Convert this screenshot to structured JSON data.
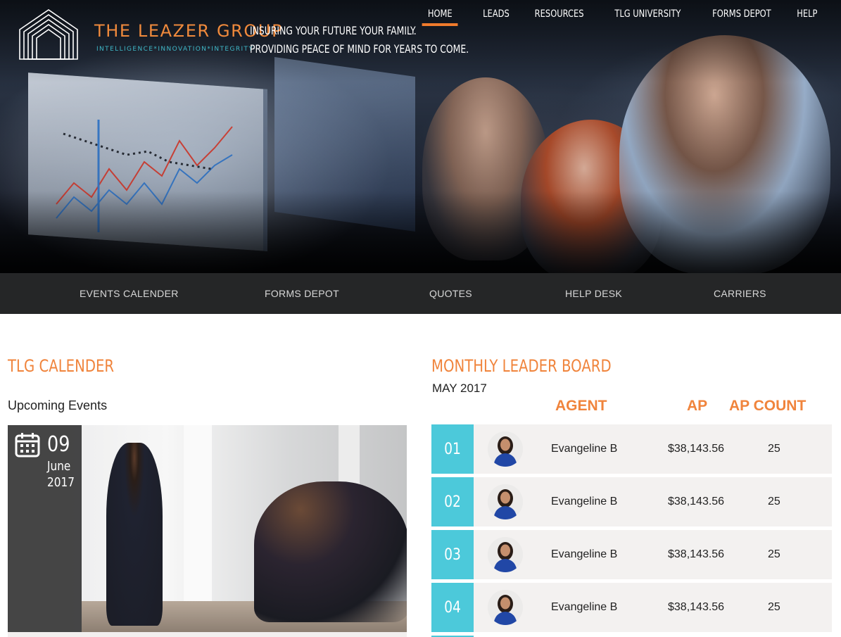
{
  "brand": {
    "name": "THE LEAZER GROUP",
    "tagline": "INTELLIGENCE*INNOVATION*INTEGRITY",
    "slogan_line1": "INSURING YOUR FUTURE YOUR FAMILY.",
    "slogan_line2": "PROVIDING PEACE OF MIND FOR YEARS TO COME."
  },
  "topnav": [
    {
      "label": "HOME",
      "active": true
    },
    {
      "label": "LEADS"
    },
    {
      "label": "RESOURCES"
    },
    {
      "label": "TLG UNIVERSITY"
    },
    {
      "label": "FORMS DEPOT"
    },
    {
      "label": "HELP"
    }
  ],
  "subnav": [
    {
      "label": "EVENTS CALENDER"
    },
    {
      "label": "FORMS DEPOT"
    },
    {
      "label": "QUOTES"
    },
    {
      "label": "HELP DESK"
    },
    {
      "label": "CARRIERS"
    }
  ],
  "calendar": {
    "title": "TLG CALENDER",
    "subtitle": "Upcoming Events",
    "event": {
      "day": "09",
      "month": "June",
      "year": "2017"
    }
  },
  "leaderboard": {
    "title": "MONTHLY LEADER BOARD",
    "month": "MAY 2017",
    "headers": {
      "agent": "AGENT",
      "ap": "AP",
      "count": "AP COUNT"
    },
    "rows": [
      {
        "rank": "01",
        "name": "Evangeline B",
        "ap": "$38,143.56",
        "count": "25"
      },
      {
        "rank": "02",
        "name": "Evangeline B",
        "ap": "$38,143.56",
        "count": "25"
      },
      {
        "rank": "03",
        "name": "Evangeline B",
        "ap": "$38,143.56",
        "count": "25"
      },
      {
        "rank": "04",
        "name": "Evangeline B",
        "ap": "$38,143.56",
        "count": "25"
      }
    ]
  },
  "colors": {
    "accent_orange": "#f0843c",
    "accent_teal": "#4cc9da",
    "subnav_bg": "#252627"
  }
}
